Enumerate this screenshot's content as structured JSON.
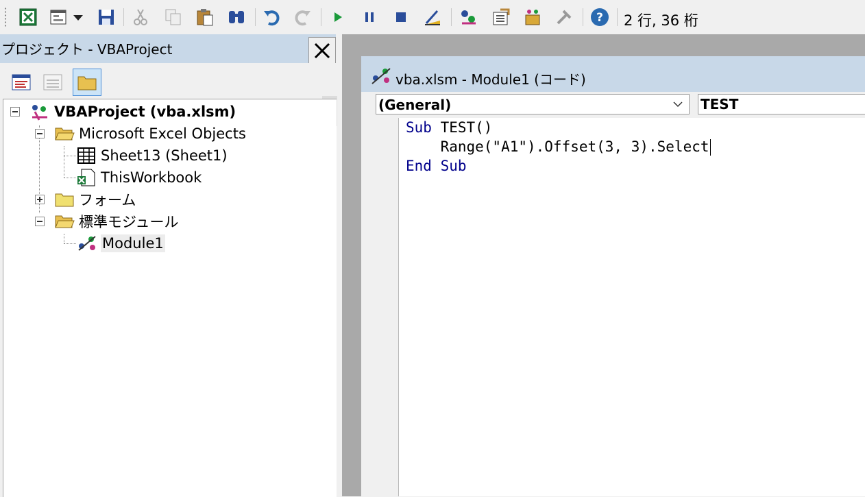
{
  "toolbar": {
    "status_position": "2 行, 36 桁",
    "buttons": [
      "excel-view-icon",
      "insert-userform-icon",
      "dropdown-arrow-icon",
      "save-icon",
      "cut-icon",
      "copy-icon",
      "paste-icon",
      "find-icon",
      "undo-icon",
      "redo-icon",
      "run-icon",
      "break-icon",
      "reset-icon",
      "design-mode-icon",
      "project-explorer-icon",
      "properties-window-icon",
      "object-browser-icon",
      "toolbox-icon",
      "help-icon"
    ]
  },
  "project_explorer": {
    "title": "プロジェクト - VBAProject",
    "tree": {
      "root": "VBAProject (vba.xlsm)",
      "folder_excel_objects": "Microsoft Excel Objects",
      "sheet": "Sheet13 (Sheet1)",
      "workbook": "ThisWorkbook",
      "folder_forms": "フォーム",
      "folder_modules": "標準モジュール",
      "module": "Module1"
    }
  },
  "code_window": {
    "title": "vba.xlsm - Module1 (コード)",
    "object_combo": "(General)",
    "procedure_combo": "TEST",
    "lines": {
      "l1_kw": "Sub",
      "l1_rest": " TEST()",
      "l2": "    Range(\"A1\").Offset(3, 3).Select",
      "l3_kw1": "End",
      "l3_kw2": "Sub"
    }
  },
  "colors": {
    "title_bar": "#c8d8e8",
    "keyword": "#00008b",
    "mdi_background": "#a9a9a9"
  }
}
